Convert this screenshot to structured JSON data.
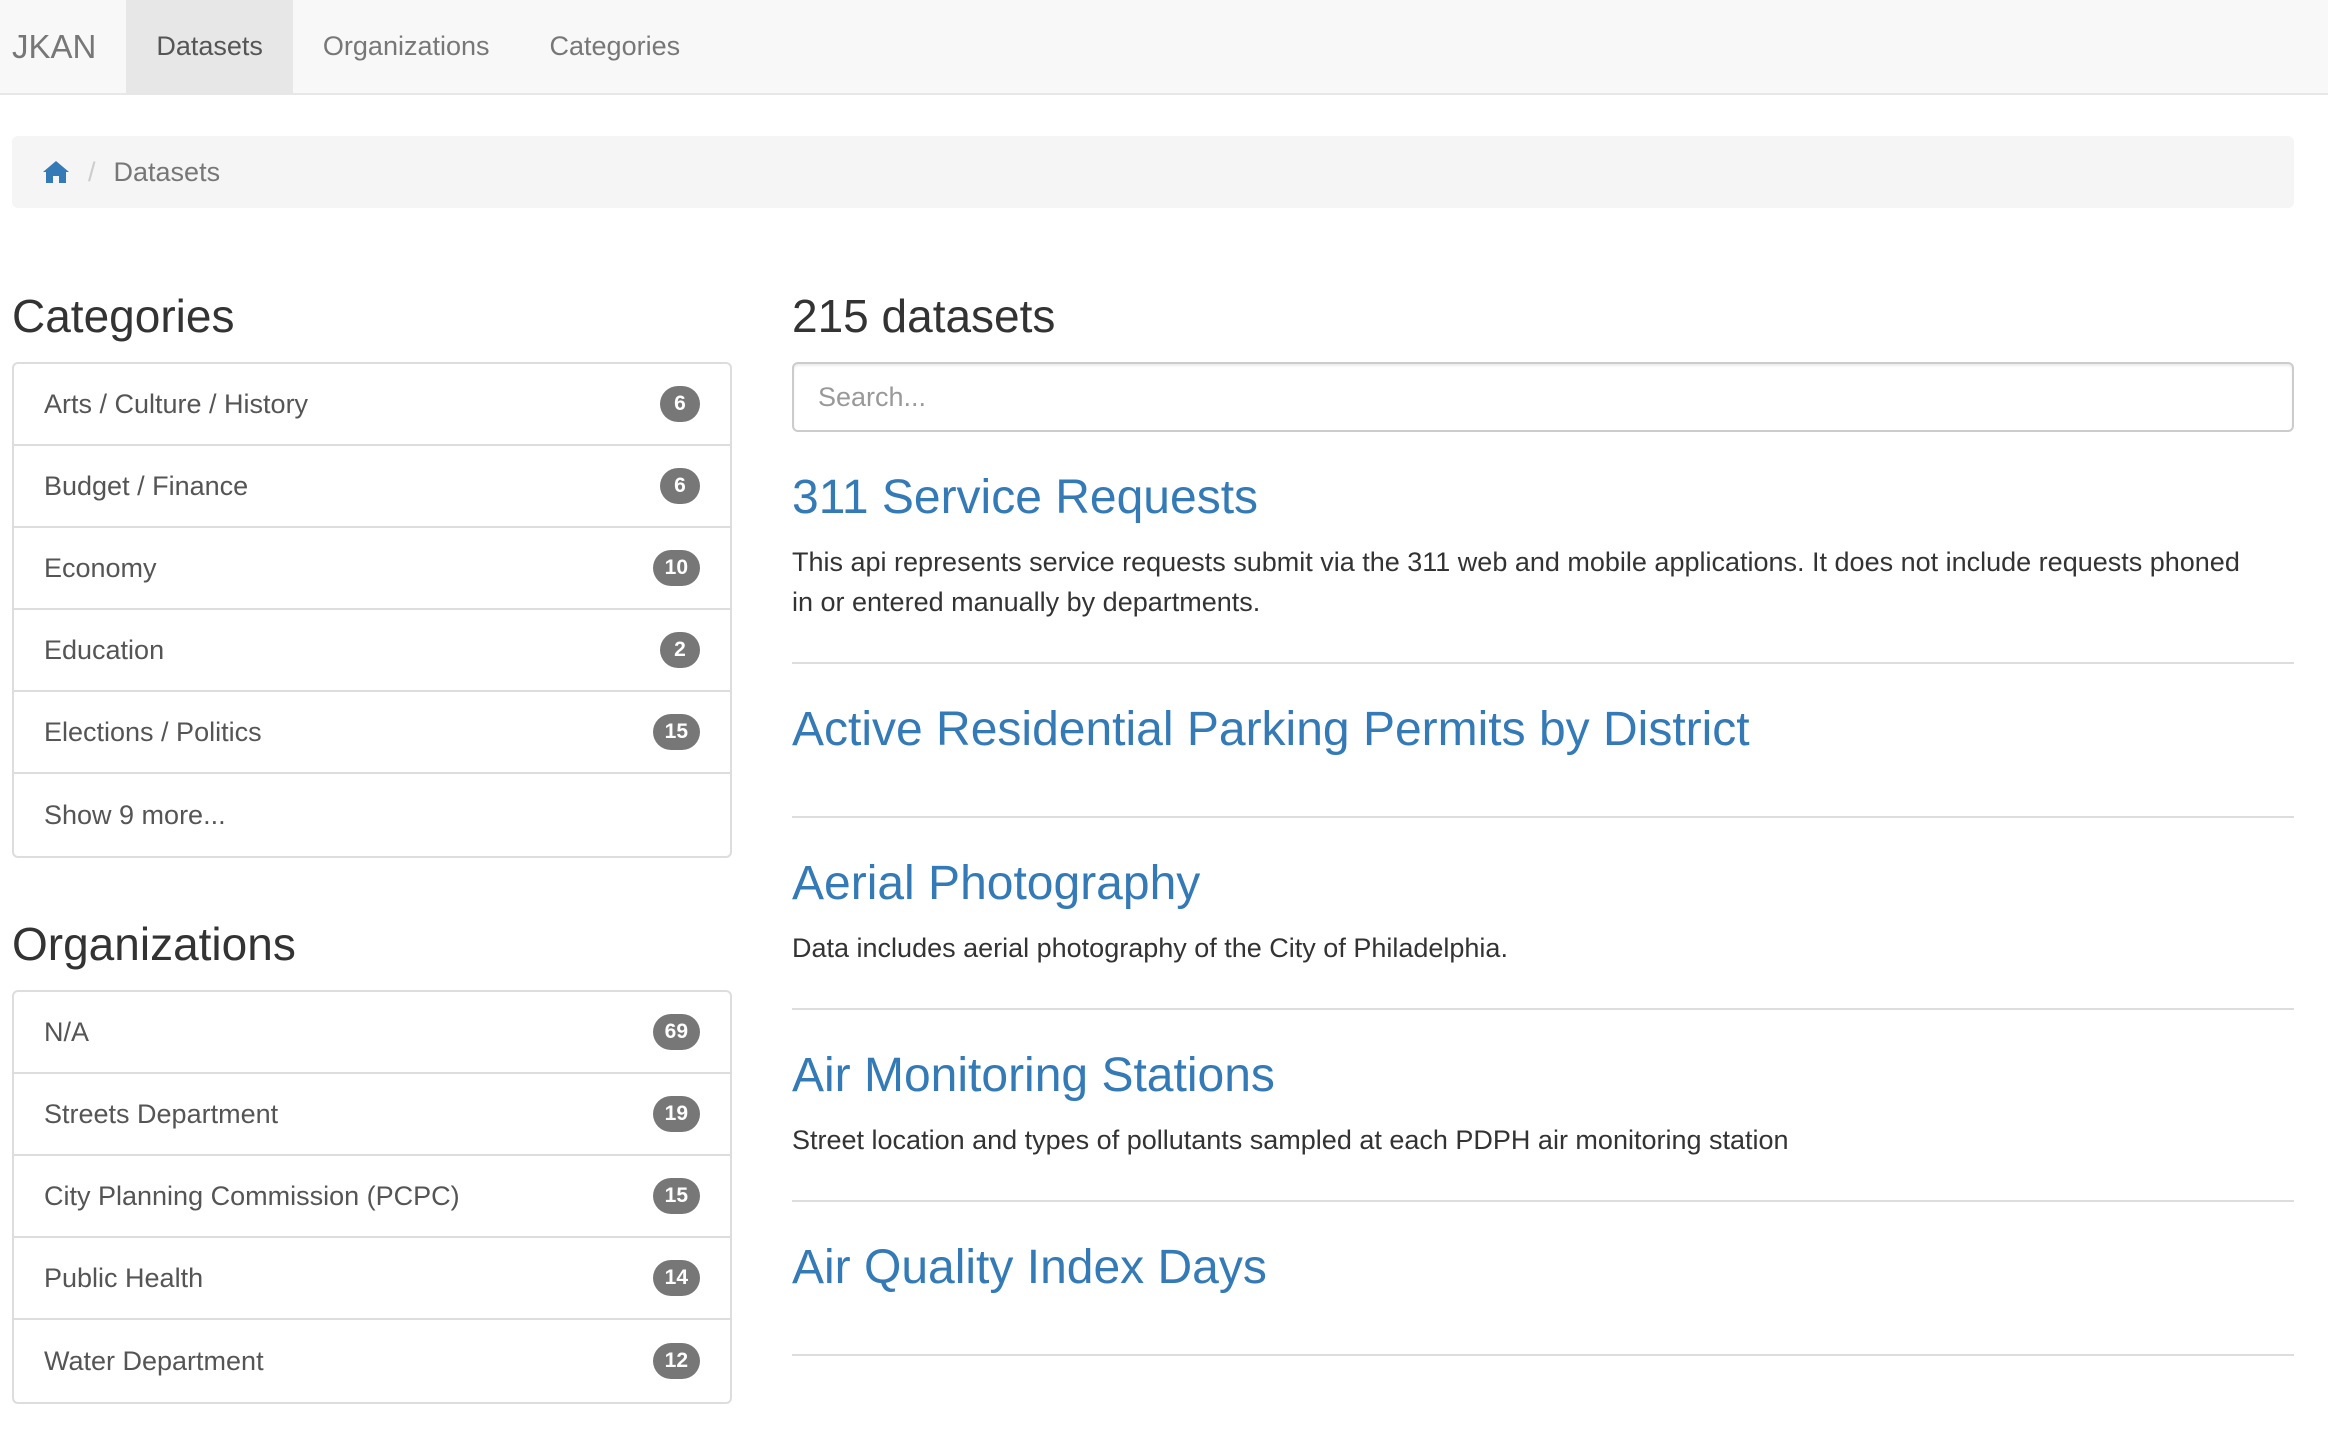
{
  "navbar": {
    "brand": "JKAN",
    "items": [
      {
        "label": "Datasets",
        "active": true
      },
      {
        "label": "Organizations",
        "active": false
      },
      {
        "label": "Categories",
        "active": false
      }
    ]
  },
  "breadcrumb": {
    "home_icon": "home-icon",
    "current": "Datasets"
  },
  "sidebar": {
    "categories": {
      "title": "Categories",
      "items": [
        {
          "label": "Arts / Culture / History",
          "count": "6"
        },
        {
          "label": "Budget / Finance",
          "count": "6"
        },
        {
          "label": "Economy",
          "count": "10"
        },
        {
          "label": "Education",
          "count": "2"
        },
        {
          "label": "Elections / Politics",
          "count": "15"
        }
      ],
      "show_more": "Show 9 more..."
    },
    "organizations": {
      "title": "Organizations",
      "items": [
        {
          "label": "N/A",
          "count": "69"
        },
        {
          "label": "Streets Department",
          "count": "19"
        },
        {
          "label": "City Planning Commission (PCPC)",
          "count": "15"
        },
        {
          "label": "Public Health",
          "count": "14"
        },
        {
          "label": "Water Department",
          "count": "12"
        }
      ]
    }
  },
  "main": {
    "count_title": "215 datasets",
    "search_placeholder": "Search...",
    "datasets": [
      {
        "title": "311 Service Requests",
        "description": "This api represents service requests submit via the 311 web and mobile applications. It does not include requests phoned in or entered manually by departments."
      },
      {
        "title": "Active Residential Parking Permits by District",
        "description": ""
      },
      {
        "title": "Aerial Photography",
        "description": "Data includes aerial photography of the City of Philadelphia."
      },
      {
        "title": "Air Monitoring Stations",
        "description": "Street location and types of pollutants sampled at each PDPH air monitoring station"
      },
      {
        "title": "Air Quality Index Days",
        "description": ""
      }
    ]
  },
  "colors": {
    "link": "#337ab7",
    "badge": "#777777",
    "navbar_bg": "#f8f8f8",
    "breadcrumb_bg": "#f5f5f5"
  }
}
